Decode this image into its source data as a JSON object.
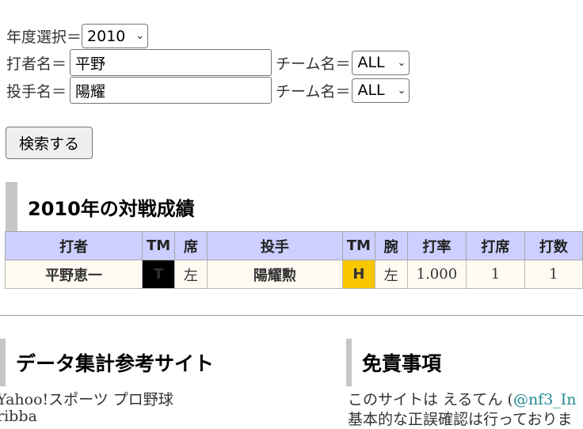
{
  "form": {
    "year_label": "年度選択＝",
    "year_value": "2010",
    "batter_label": "打者名＝",
    "batter_value": "平野",
    "pitcher_label": "投手名＝",
    "pitcher_value": "陽耀",
    "team_label": "チーム名＝",
    "batter_team_value": "ALL",
    "pitcher_team_value": "ALL",
    "search_button": "検索する"
  },
  "results": {
    "title": "2010年の対戦成績",
    "headers": [
      "打者",
      "TM",
      "席",
      "投手",
      "TM",
      "腕",
      "打率",
      "打席",
      "打数"
    ],
    "row": {
      "batter": "平野恵一",
      "batter_tm": "T",
      "seat": "左",
      "pitcher": "陽耀勲",
      "pitcher_tm": "H",
      "arm": "左",
      "avg": "1.000",
      "pa": "1",
      "ab": "1"
    }
  },
  "footer": {
    "ref_title": "データ集計参考サイト",
    "ref_link1": "Yahoo!スポーツ プロ野球",
    "ref_link2_partial": "ribba",
    "disclaimer_title": "免責事項",
    "disclaimer_text_prefix": "このサイトは えるてん (",
    "disclaimer_handle": "@nf3_In",
    "disclaimer_line2": "基本的な正誤確認は行っておりま"
  },
  "colors": {
    "header_bg": "#cccfff",
    "row_bg": "#fffbf3",
    "link": "#1f8a90",
    "tigers_bg": "#000000",
    "tigers_fg": "#f5c400",
    "hawks_bg": "#f9c600"
  },
  "icons": {
    "dropdown": "chevron-down-icon"
  }
}
